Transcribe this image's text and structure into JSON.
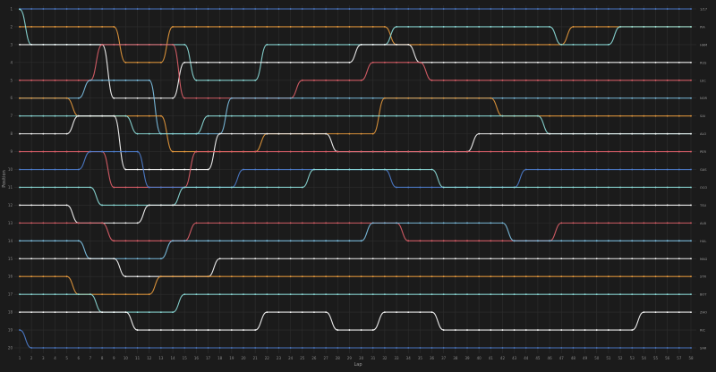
{
  "chart_data": {
    "type": "line",
    "subtype": "position-bump-chart",
    "xlabel": "Lap",
    "ylabel": "Position",
    "xlim": [
      1,
      58
    ],
    "ylim": [
      1,
      20
    ],
    "y_inverted": true,
    "grid": true,
    "legend": "right-end labels",
    "x_ticks": [
      1,
      2,
      3,
      4,
      5,
      6,
      7,
      8,
      9,
      10,
      11,
      12,
      13,
      14,
      15,
      16,
      17,
      18,
      19,
      20,
      21,
      22,
      23,
      24,
      25,
      26,
      27,
      28,
      29,
      30,
      31,
      32,
      33,
      34,
      35,
      36,
      37,
      38,
      39,
      40,
      41,
      42,
      43,
      44,
      45,
      46,
      47,
      48,
      49,
      50,
      51,
      52,
      53,
      54,
      55,
      56,
      57,
      58
    ],
    "y_ticks": [
      1,
      2,
      3,
      4,
      5,
      6,
      7,
      8,
      9,
      10,
      11,
      12,
      13,
      14,
      15,
      16,
      17,
      18,
      19,
      20
    ],
    "palette": [
      "#4f7fd1",
      "#e89a3c",
      "#8ee0dd",
      "#ffffff",
      "#e0606a",
      "#7fc4e8"
    ],
    "series": [
      {
        "name": "VER",
        "color": "#4f7fd1",
        "start": 1,
        "stays": [
          [
            1,
            1
          ]
        ]
      },
      {
        "name": "PIA",
        "color": "#e89a3c",
        "start": 2,
        "stays": [
          [
            1,
            2
          ],
          [
            10,
            4
          ],
          [
            14,
            2
          ],
          [
            24,
            2
          ],
          [
            33,
            3
          ],
          [
            48,
            2
          ]
        ]
      },
      {
        "name": "HAM",
        "color": "#8ee0dd",
        "start": 3,
        "stays": [
          [
            1,
            1.02
          ],
          [
            2,
            3
          ],
          [
            12,
            3
          ],
          [
            16,
            5
          ],
          [
            22,
            3
          ],
          [
            33,
            2
          ],
          [
            47,
            3
          ],
          [
            52,
            2
          ]
        ]
      },
      {
        "name": "RUS",
        "color": "#ffffff",
        "start": 3,
        "stays": [
          [
            1,
            3
          ],
          [
            9,
            6
          ],
          [
            15,
            4
          ],
          [
            30,
            3
          ],
          [
            35,
            4
          ],
          [
            48,
            4
          ]
        ]
      },
      {
        "name": "LEC",
        "color": "#e0606a",
        "start": 5,
        "stays": [
          [
            1,
            5
          ],
          [
            8,
            3
          ],
          [
            15,
            6
          ],
          [
            25,
            5
          ],
          [
            31,
            4
          ],
          [
            36,
            5
          ],
          [
            45,
            5
          ]
        ]
      },
      {
        "name": "NOR",
        "color": "#7fc4e8",
        "start": 6,
        "stays": [
          [
            1,
            6
          ],
          [
            7,
            5
          ],
          [
            13,
            8
          ],
          [
            19,
            6
          ],
          [
            27,
            6
          ],
          [
            41,
            6
          ]
        ]
      },
      {
        "name": "SAI",
        "color": "#e89a3c",
        "start": 6,
        "stays": [
          [
            1,
            6
          ],
          [
            6,
            7
          ],
          [
            14,
            9
          ],
          [
            22,
            8
          ],
          [
            32,
            6
          ],
          [
            42,
            7
          ]
        ]
      },
      {
        "name": "ALO",
        "color": "#8ee0dd",
        "start": 7,
        "stays": [
          [
            1,
            7
          ],
          [
            11,
            8
          ],
          [
            17,
            7
          ],
          [
            23,
            7
          ],
          [
            34,
            7
          ],
          [
            46,
            8
          ]
        ]
      },
      {
        "name": "PER",
        "color": "#ffffff",
        "start": 8,
        "stays": [
          [
            1,
            8
          ],
          [
            6,
            7
          ],
          [
            10,
            10
          ],
          [
            18,
            8
          ],
          [
            28,
            9
          ],
          [
            40,
            8
          ]
        ]
      },
      {
        "name": "GAS",
        "color": "#e0606a",
        "start": 9,
        "stays": [
          [
            1,
            9
          ],
          [
            9,
            11
          ],
          [
            16,
            9
          ],
          [
            24,
            9
          ],
          [
            38,
            9
          ],
          [
            50,
            9
          ]
        ]
      },
      {
        "name": "OCO",
        "color": "#4f7fd1",
        "start": 10,
        "stays": [
          [
            1,
            10
          ],
          [
            7,
            9
          ],
          [
            12,
            11
          ],
          [
            20,
            10
          ],
          [
            33,
            11
          ],
          [
            44,
            10
          ]
        ]
      },
      {
        "name": "TSU",
        "color": "#8ee0dd",
        "start": 11,
        "stays": [
          [
            1,
            11
          ],
          [
            8,
            12
          ],
          [
            15,
            11
          ],
          [
            26,
            10
          ],
          [
            37,
            11
          ],
          [
            46,
            11
          ]
        ]
      },
      {
        "name": "ALB",
        "color": "#ffffff",
        "start": 12,
        "stays": [
          [
            1,
            12
          ],
          [
            6,
            13
          ],
          [
            12,
            12
          ],
          [
            22,
            12
          ],
          [
            30,
            12
          ],
          [
            42,
            12
          ]
        ]
      },
      {
        "name": "HUL",
        "color": "#e0606a",
        "start": 13,
        "stays": [
          [
            1,
            13
          ],
          [
            9,
            14
          ],
          [
            16,
            13
          ],
          [
            24,
            13
          ],
          [
            34,
            14
          ],
          [
            47,
            13
          ]
        ]
      },
      {
        "name": "MAG",
        "color": "#7fc4e8",
        "start": 14,
        "stays": [
          [
            1,
            14
          ],
          [
            7,
            15
          ],
          [
            14,
            14
          ],
          [
            21,
            14
          ],
          [
            31,
            13
          ],
          [
            43,
            14
          ]
        ]
      },
      {
        "name": "STR",
        "color": "#ffffff",
        "start": 15,
        "stays": [
          [
            1,
            15
          ],
          [
            10,
            16
          ],
          [
            18,
            15
          ],
          [
            27,
            15
          ],
          [
            39,
            15
          ],
          [
            51,
            15
          ]
        ]
      },
      {
        "name": "BOT",
        "color": "#e89a3c",
        "start": 16,
        "stays": [
          [
            1,
            16
          ],
          [
            6,
            17
          ],
          [
            13,
            16
          ],
          [
            20,
            16
          ],
          [
            32,
            16
          ],
          [
            45,
            16
          ]
        ]
      },
      {
        "name": "ZHO",
        "color": "#8ee0dd",
        "start": 17,
        "stays": [
          [
            1,
            17
          ],
          [
            8,
            18
          ],
          [
            15,
            17
          ],
          [
            25,
            17
          ],
          [
            36,
            17
          ],
          [
            48,
            17
          ]
        ]
      },
      {
        "name": "RIC",
        "color": "#ffffff",
        "start": 18,
        "stays": [
          [
            1,
            18
          ],
          [
            11,
            19
          ],
          [
            22,
            18
          ],
          [
            28,
            19
          ],
          [
            32,
            18
          ],
          [
            37,
            19
          ],
          [
            54,
            18
          ]
        ]
      },
      {
        "name": "SAR",
        "color": "#4f7fd1",
        "start": 19,
        "stays": [
          [
            1,
            19
          ],
          [
            2,
            20
          ],
          [
            4,
            20
          ]
        ]
      }
    ],
    "right_labels": [
      "1/17",
      "PIA",
      "HAM",
      "RUS",
      "LEC",
      "NOR",
      "SAI",
      "ALO",
      "PER",
      "GAS",
      "OCO",
      "TSU",
      "ALB",
      "HUL",
      "MAG",
      "STR",
      "BOT",
      "ZHO",
      "RIC",
      "SAR"
    ]
  }
}
